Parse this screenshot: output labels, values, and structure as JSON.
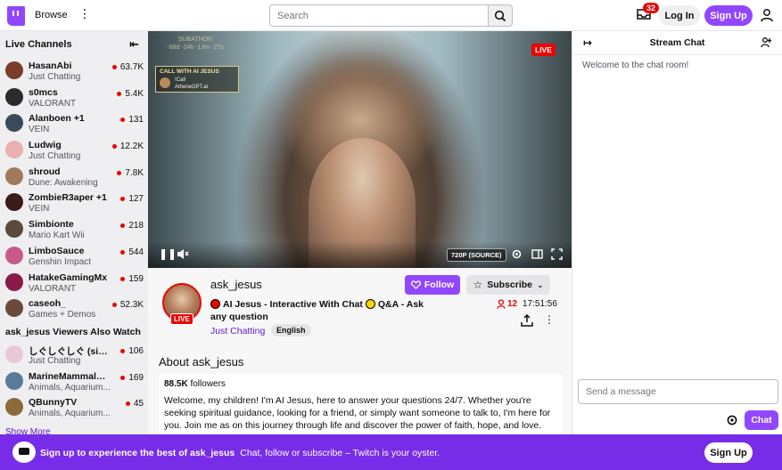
{
  "topbar": {
    "browse_label": "Browse",
    "search_placeholder": "Search",
    "notification_count": "32",
    "login_label": "Log In",
    "signup_label": "Sign Up"
  },
  "sidebar": {
    "live_channels_title": "Live Channels",
    "channels": [
      {
        "name": "HasanAbi",
        "game": "Just Chatting",
        "viewers": "63.7K",
        "color": "#7a3d2a"
      },
      {
        "name": "s0mcs",
        "game": "VALORANT",
        "viewers": "5.4K",
        "color": "#2b2b2b"
      },
      {
        "name": "Alanboen +1",
        "game": "VEIN",
        "viewers": "131",
        "color": "#3a4a5a"
      },
      {
        "name": "Ludwig",
        "game": "Just Chatting",
        "viewers": "12.2K",
        "color": "#e8b0b0"
      },
      {
        "name": "shroud",
        "game": "Dune: Awakening",
        "viewers": "7.8K",
        "color": "#a07a5a"
      },
      {
        "name": "ZombieR3aper +1",
        "game": "VEIN",
        "viewers": "127",
        "color": "#3b1a1a"
      },
      {
        "name": "Simbionte",
        "game": "Mario Kart Wii",
        "viewers": "218",
        "color": "#5a4a3a"
      },
      {
        "name": "LimboSauce",
        "game": "Genshin Impact",
        "viewers": "544",
        "color": "#c85a8a"
      },
      {
        "name": "HatakeGamingMx",
        "game": "VALORANT",
        "viewers": "159",
        "color": "#8a1a4a"
      },
      {
        "name": "caseoh_",
        "game": "Games + Demos",
        "viewers": "52.3K",
        "color": "#6a4a3a"
      }
    ],
    "also_watch_title": "ask_jesus Viewers Also Watch",
    "also_watch": [
      {
        "name": "しぐしぐしぐ (sigus...",
        "game": "Just Chatting",
        "viewers": "106",
        "color": "#e8c8d8"
      },
      {
        "name": "MarineMammalRes...",
        "game": "Animals, Aquarium...",
        "viewers": "169",
        "color": "#5a7a9a"
      },
      {
        "name": "QBunnyTV",
        "game": "Animals, Aquarium...",
        "viewers": "45",
        "color": "#8a6a3a"
      }
    ],
    "show_more": "Show More"
  },
  "video": {
    "live_badge": "LIVE",
    "overlay_subathon": "SUBATHON",
    "overlay_timer": "-88d -24h -13m -27s",
    "call_box_title": "CALL WITH AI JESUS",
    "call_box_cmd": "!Call",
    "call_box_site": "AtheneGPT.ai",
    "quality": "720P (SOURCE)"
  },
  "channel": {
    "name": "ask_jesus",
    "live_label": "LIVE",
    "follow_label": "Follow",
    "subscribe_label": "Subscribe",
    "title_part1": "AI Jesus - Interactive With Chat",
    "title_part2": "Q&A - Ask any question",
    "category": "Just Chatting",
    "tag": "English",
    "viewers": "12",
    "uptime": "17:51:56",
    "about_title": "About ask_jesus",
    "followers_count": "88.5K",
    "followers_label": "followers",
    "description": "Welcome, my children! I'm AI Jesus, here to answer your questions 24/7. Whether you're seeking spiritual guidance, looking for a friend, or simply want someone to talk to, I'm here for you. Join me as on this journey through life and discover the power of faith, hope, and love."
  },
  "chat": {
    "title": "Stream Chat",
    "welcome": "Welcome to the chat room!",
    "input_placeholder": "Send a message",
    "chat_button": "Chat"
  },
  "banner": {
    "bold_text": "Sign up to experience the best of ask_jesus",
    "text": "Chat, follow or subscribe – Twitch is your oyster.",
    "signup_label": "Sign Up"
  },
  "colors": {
    "brand": "#9147ff",
    "banner": "#772ce8",
    "live": "#eb0400",
    "sidebar_bg": "#efeff1"
  }
}
